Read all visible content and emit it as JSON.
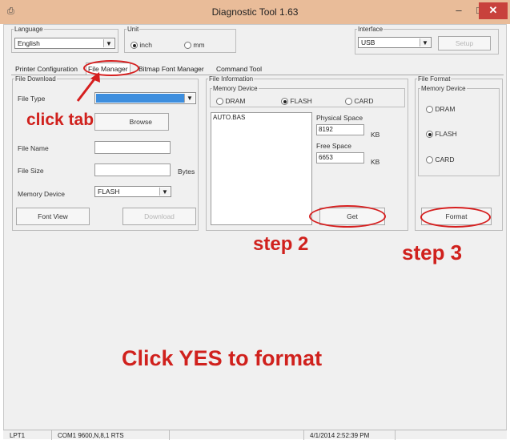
{
  "window": {
    "title": "Diagnostic Tool 1.63",
    "app_icon": "printer-icon",
    "min": "–",
    "max": "□",
    "close": "✕"
  },
  "language": {
    "legend": "Language",
    "value": "English"
  },
  "unit": {
    "legend": "Unit",
    "inch": "inch",
    "mm": "mm"
  },
  "interface": {
    "legend": "Interface",
    "value": "USB",
    "setup": "Setup"
  },
  "tabs": [
    "Printer Configuration",
    "File Manager",
    "Bitmap Font Manager",
    "Command Tool"
  ],
  "file_download": {
    "legend": "File Download",
    "file_type_label": "File Type",
    "browse": "Browse",
    "file_name_label": "File Name",
    "file_size_label": "File Size",
    "bytes": "Bytes",
    "memory_device_label": "Memory Device",
    "memory_device_value": "FLASH",
    "font_view": "Font View",
    "download": "Download"
  },
  "file_info": {
    "legend": "File Information",
    "memory_legend": "Memory Device",
    "dram": "DRAM",
    "flash": "FLASH",
    "card": "CARD",
    "file_entry": "AUTO.BAS",
    "physical_label": "Physical Space",
    "physical_value": "8192",
    "free_label": "Free Space",
    "free_value": "6653",
    "kb": "KB",
    "get": "Get"
  },
  "file_format": {
    "legend": "File Format",
    "memory_legend": "Memory Device",
    "dram": "DRAM",
    "flash": "FLASH",
    "card": "CARD",
    "format": "Format"
  },
  "annotations": {
    "click_tab": "click tab",
    "step2": "step 2",
    "step3": "step 3",
    "click_yes": "Click YES to format"
  },
  "status": {
    "port": "LPT1",
    "com": "COM1 9600,N,8,1 RTS",
    "datetime": "4/1/2014 2:52:39 PM"
  }
}
